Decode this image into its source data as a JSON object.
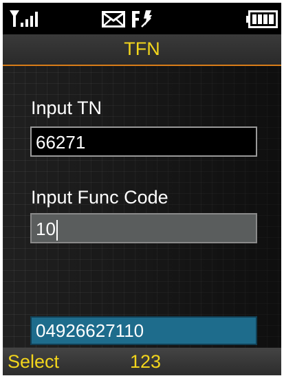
{
  "title": "TFN",
  "status_icons": [
    "signal-icon",
    "mail-icon",
    "forward-icon",
    "battery-icon"
  ],
  "fields": {
    "tn_label": "Input TN",
    "tn_value": "66271",
    "func_label": "Input Func Code",
    "func_value": "10",
    "result_value": "04926627110"
  },
  "softkeys": {
    "left": "Select",
    "center": "123"
  },
  "colors": {
    "accent": "#f2d51c",
    "title_underline": "#d97d19",
    "result_background": "#1e6c8c",
    "active_field_background": "#5a5d5d"
  }
}
